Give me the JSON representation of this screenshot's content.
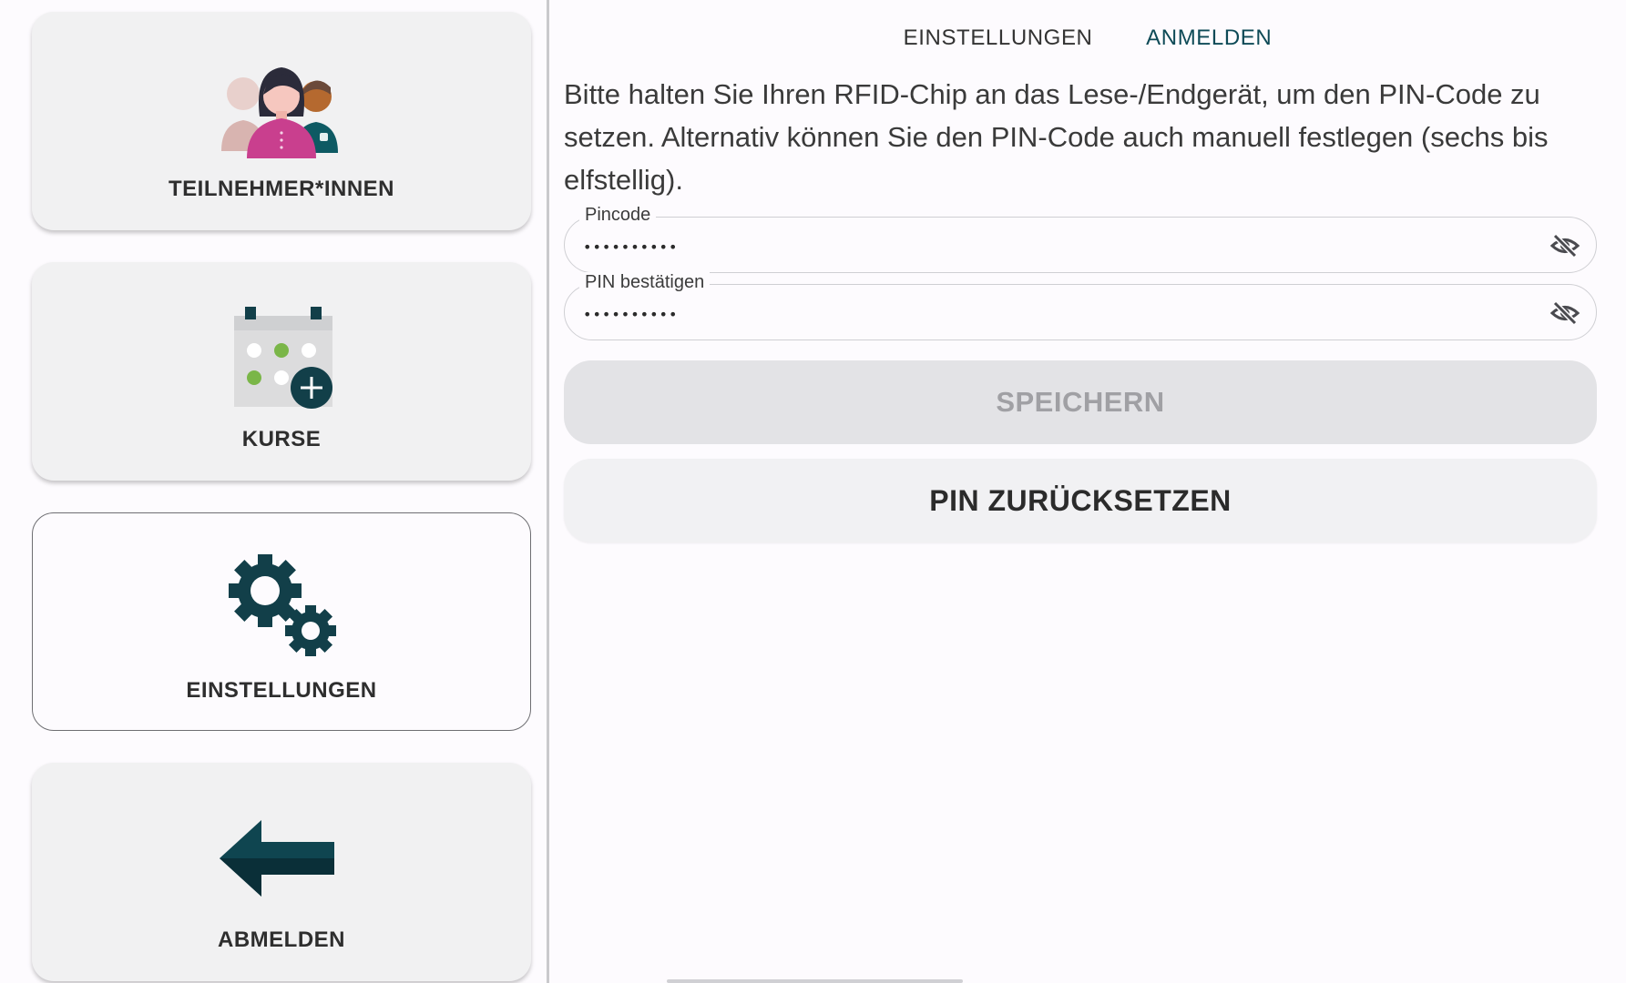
{
  "sidebar": {
    "items": [
      {
        "label": "TEILNEHMER*INNEN",
        "icon": "participants-icon"
      },
      {
        "label": "KURSE",
        "icon": "calendar-add-icon"
      },
      {
        "label": "EINSTELLUNGEN",
        "icon": "gears-icon",
        "selected": true
      },
      {
        "label": "ABMELDEN",
        "icon": "arrow-left-icon"
      }
    ]
  },
  "tabs": [
    {
      "label": "EINSTELLUNGEN",
      "active": false
    },
    {
      "label": "ANMELDEN",
      "active": true
    }
  ],
  "info_text": "Bitte halten Sie Ihren RFID-Chip an das Lese-/Endgerät, um den PIN-Code zu setzen. Alternativ können Sie den PIN-Code auch manuell festlegen (sechs bis elfstellig).",
  "form": {
    "pincode": {
      "label": "Pincode",
      "value": "••••••••••",
      "icon": "eye-off-icon"
    },
    "pin_confirm": {
      "label": "PIN bestätigen",
      "value": "••••••••••",
      "icon": "eye-off-icon"
    },
    "save_label": "SPEICHERN",
    "reset_label": "PIN ZURÜCKSETZEN"
  },
  "colors": {
    "accent": "#0e4a57",
    "dark_teal": "#123f49",
    "tile_background": "#f1f1f2",
    "page_background": "#fdfbfe",
    "disabled_text": "#a0a0a4",
    "calendar_green": "#7ab648",
    "person_pink": "#c93f8e"
  }
}
